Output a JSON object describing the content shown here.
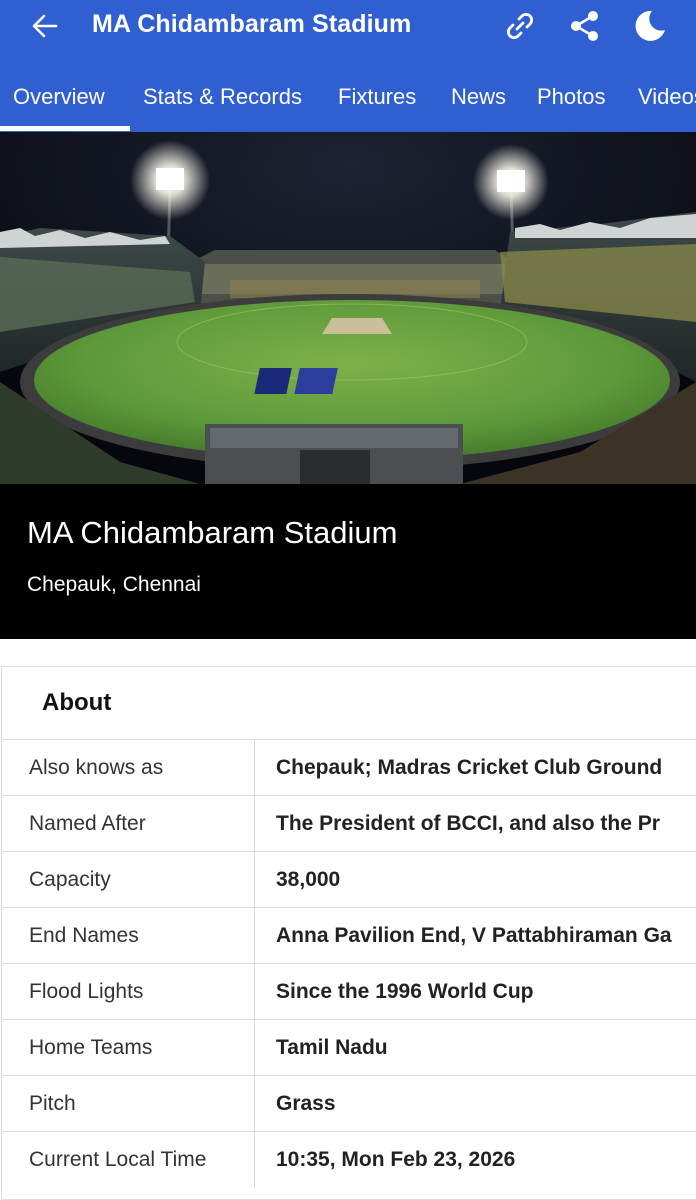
{
  "appbar": {
    "title": "MA Chidambaram Stadium",
    "icons": [
      "arrow-left-icon",
      "link-icon",
      "share-icon",
      "moon-icon"
    ],
    "color": "#2f5fd0"
  },
  "tabs": [
    {
      "label": "Overview",
      "active": true
    },
    {
      "label": "Stats & Records",
      "active": false
    },
    {
      "label": "Fixtures",
      "active": false
    },
    {
      "label": "News",
      "active": false
    },
    {
      "label": "Photos",
      "active": false
    },
    {
      "label": "Videos",
      "active": false
    }
  ],
  "venue": {
    "name": "MA Chidambaram Stadium",
    "location": "Chepauk, Chennai"
  },
  "about": {
    "heading": "About",
    "rows": [
      {
        "label": "Also knows as",
        "value": "Chepauk; Madras Cricket Club Ground"
      },
      {
        "label": "Named After",
        "value": "The President of BCCI, and also the Pr"
      },
      {
        "label": "Capacity",
        "value": "38,000"
      },
      {
        "label": "End Names",
        "value": "Anna Pavilion End, V Pattabhiraman Ga"
      },
      {
        "label": "Flood Lights",
        "value": "Since the 1996 World Cup"
      },
      {
        "label": "Home Teams",
        "value": "Tamil Nadu"
      },
      {
        "label": "Pitch",
        "value": "Grass"
      },
      {
        "label": "Current Local Time",
        "value": "10:35, Mon Feb 23, 2026"
      }
    ]
  }
}
